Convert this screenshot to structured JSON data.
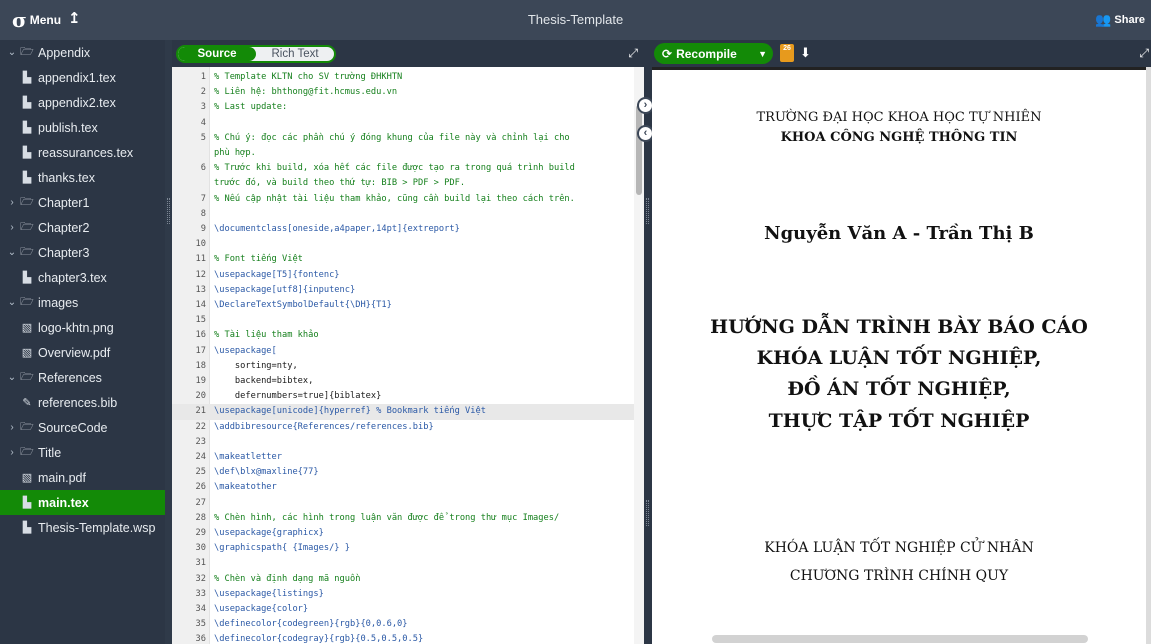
{
  "topbar": {
    "menu_label": "Menu",
    "title": "Thesis-Template",
    "share_label": "Share"
  },
  "sidebar": {
    "items": [
      {
        "label": "Appendix",
        "type": "folder",
        "expanded": true,
        "level": 0
      },
      {
        "label": "appendix1.tex",
        "type": "file",
        "level": 1
      },
      {
        "label": "appendix2.tex",
        "type": "file",
        "level": 1
      },
      {
        "label": "publish.tex",
        "type": "file",
        "level": 1
      },
      {
        "label": "reassurances.tex",
        "type": "file",
        "level": 1
      },
      {
        "label": "thanks.tex",
        "type": "file",
        "level": 1
      },
      {
        "label": "Chapter1",
        "type": "folder",
        "expanded": false,
        "level": 0
      },
      {
        "label": "Chapter2",
        "type": "folder",
        "expanded": false,
        "level": 0
      },
      {
        "label": "Chapter3",
        "type": "folder",
        "expanded": true,
        "level": 0
      },
      {
        "label": "chapter3.tex",
        "type": "file",
        "level": 1
      },
      {
        "label": "images",
        "type": "folder",
        "expanded": true,
        "level": 0
      },
      {
        "label": "logo-khtn.png",
        "type": "image",
        "level": 1
      },
      {
        "label": "Overview.pdf",
        "type": "image",
        "level": 1
      },
      {
        "label": "References",
        "type": "folder",
        "expanded": true,
        "level": 0
      },
      {
        "label": "references.bib",
        "type": "bib",
        "level": 1
      },
      {
        "label": "SourceCode",
        "type": "folder",
        "expanded": false,
        "level": 0
      },
      {
        "label": "Title",
        "type": "folder",
        "expanded": false,
        "level": 0
      },
      {
        "label": "main.pdf",
        "type": "image",
        "level": 0
      },
      {
        "label": "main.tex",
        "type": "file",
        "level": 0,
        "active": true
      },
      {
        "label": "Thesis-Template.wsp",
        "type": "file",
        "level": 0
      }
    ]
  },
  "editor": {
    "source_label": "Source",
    "richtext_label": "Rich Text",
    "current_line": 21,
    "lines": [
      {
        "n": "1",
        "text": "% Template KLTN cho SV trường ĐHKHTN",
        "kind": "comment"
      },
      {
        "n": "2",
        "text": "% Liên hệ: bhthong@fit.hcmus.edu.vn",
        "kind": "comment"
      },
      {
        "n": "3",
        "text": "% Last update:",
        "kind": "comment"
      },
      {
        "n": "4",
        "text": "",
        "kind": "plain"
      },
      {
        "n": "5",
        "text": "% Chú ý: đọc các phần chú ý đóng khung của file này và chỉnh lại cho",
        "kind": "comment"
      },
      {
        "n": "",
        "text": "phù hợp.",
        "kind": "comment"
      },
      {
        "n": "6",
        "text": "% Trước khi build, xóa hết các file được tạo ra trong quá trình build",
        "kind": "comment"
      },
      {
        "n": "",
        "text": "trước đó, và build theo thứ tự: BIB > PDF > PDF.",
        "kind": "comment"
      },
      {
        "n": "7",
        "text": "% Nếu cập nhật tài liệu tham khảo, cũng cần build lại theo cách trên.",
        "kind": "comment"
      },
      {
        "n": "8",
        "text": "",
        "kind": "plain"
      },
      {
        "n": "9",
        "text": "\\documentclass[oneside,a4paper,14pt]{extreport}",
        "kind": "keyword"
      },
      {
        "n": "10",
        "text": "",
        "kind": "plain"
      },
      {
        "n": "11",
        "text": "% Font tiếng Việt",
        "kind": "comment"
      },
      {
        "n": "12",
        "text": "\\usepackage[T5]{fontenc}",
        "kind": "keyword"
      },
      {
        "n": "13",
        "text": "\\usepackage[utf8]{inputenc}",
        "kind": "keyword"
      },
      {
        "n": "14",
        "text": "\\DeclareTextSymbolDefault{\\DH}{T1}",
        "kind": "keyword"
      },
      {
        "n": "15",
        "text": "",
        "kind": "plain"
      },
      {
        "n": "16",
        "text": "% Tài liệu tham khảo",
        "kind": "comment"
      },
      {
        "n": "17",
        "text": "\\usepackage[",
        "kind": "keyword"
      },
      {
        "n": "18",
        "text": "    sorting=nty,",
        "kind": "plain"
      },
      {
        "n": "19",
        "text": "    backend=bibtex,",
        "kind": "plain"
      },
      {
        "n": "20",
        "text": "    defernumbers=true]{biblatex}",
        "kind": "plain"
      },
      {
        "n": "21",
        "text": "\\usepackage[unicode]{hyperref} % Bookmark tiếng Việt",
        "kind": "keyword"
      },
      {
        "n": "22",
        "text": "\\addbibresource{References/references.bib}",
        "kind": "keyword"
      },
      {
        "n": "23",
        "text": "",
        "kind": "plain"
      },
      {
        "n": "24",
        "text": "\\makeatletter",
        "kind": "keyword"
      },
      {
        "n": "25",
        "text": "\\def\\blx@maxline{77}",
        "kind": "keyword"
      },
      {
        "n": "26",
        "text": "\\makeatother",
        "kind": "keyword"
      },
      {
        "n": "27",
        "text": "",
        "kind": "plain"
      },
      {
        "n": "28",
        "text": "% Chèn hình, các hình trong luận văn được để trong thư mục Images/",
        "kind": "comment"
      },
      {
        "n": "29",
        "text": "\\usepackage{graphicx}",
        "kind": "keyword"
      },
      {
        "n": "30",
        "text": "\\graphicspath{ {Images/} }",
        "kind": "keyword"
      },
      {
        "n": "31",
        "text": "",
        "kind": "plain"
      },
      {
        "n": "32",
        "text": "% Chèn và định dạng mã nguồn",
        "kind": "comment"
      },
      {
        "n": "33",
        "text": "\\usepackage{listings}",
        "kind": "keyword"
      },
      {
        "n": "34",
        "text": "\\usepackage{color}",
        "kind": "keyword"
      },
      {
        "n": "35",
        "text": "\\definecolor{codegreen}{rgb}{0,0.6,0}",
        "kind": "keyword"
      },
      {
        "n": "36",
        "text": "\\definecolor{codegray}{rgb}{0.5,0.5,0.5}",
        "kind": "keyword"
      }
    ]
  },
  "preview": {
    "recompile_label": "Recompile",
    "logs_count": "26",
    "university": "TRƯỜNG ĐẠI HỌC KHOA HỌC TỰ NHIÊN",
    "faculty": "KHOA CÔNG NGHỆ THÔNG TIN",
    "authors": "Nguyễn Văn A - Trần Thị B",
    "title_lines": [
      "HƯỚNG DẪN TRÌNH BÀY BÁO CÁO",
      "KHÓA LUẬN TỐT NGHIỆP,",
      "ĐỒ ÁN TỐT NGHIỆP,",
      "THỰC TẬP TỐT NGHIỆP"
    ],
    "degree": "KHÓA LUẬN TỐT NGHIỆP CỬ NHÂN",
    "program": "CHƯƠNG TRÌNH CHÍNH QUY"
  },
  "colors": {
    "accent": "#138a07",
    "topbar": "#3c4757",
    "sidebar": "#2c3645",
    "comment": "#16801d",
    "keyword": "#2b59a6",
    "logs_badge": "#e79a1d"
  },
  "icons": {
    "menu": "overleaf-logo-icon",
    "up": "up-arrow-icon",
    "share": "people-icon",
    "folder": "folder-icon",
    "file": "file-icon",
    "image": "image-icon",
    "bib": "pencil-file-icon",
    "recompile": "refresh-icon",
    "logs": "logs-icon",
    "download": "download-icon"
  }
}
